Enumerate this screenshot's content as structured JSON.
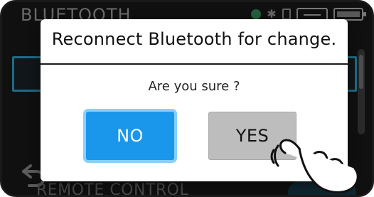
{
  "screen": {
    "title": "BLUETOOTH",
    "subtitle": "",
    "bottom_label": "REMOTE CONTROL"
  },
  "dialog": {
    "title": "Reconnect Bluetooth for change.",
    "message": "Are you sure ?",
    "no_label": "NO",
    "yes_label": "YES"
  },
  "colors": {
    "no_button": "#1a97ea",
    "yes_button": "#bdbdbd",
    "selection_outline": "#1e6b86"
  },
  "icons": {
    "status": [
      "status-dot-icon",
      "bluetooth-icon",
      "sd-card-icon",
      "usb-icon",
      "battery-icon"
    ],
    "navigation": [
      "back-icon"
    ],
    "overlay": [
      "hand-tap-icon"
    ]
  }
}
